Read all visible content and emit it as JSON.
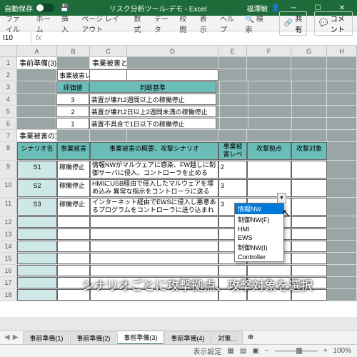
{
  "titlebar": {
    "autosave": "自動保存",
    "title": "リスク分析ツール-デモ - Excel",
    "user": "福澤敏"
  },
  "tabs": [
    "ファイル",
    "ホーム",
    "挿入",
    "ページ レイアウト",
    "数式",
    "データ",
    "校閲",
    "表示",
    "ヘルプ",
    "検索"
  ],
  "share": "共有",
  "comment": "コメント",
  "namebox": "I10",
  "cols": [
    "A",
    "B",
    "C",
    "D",
    "E",
    "F",
    "G",
    "H"
  ],
  "sec1": "事前準備(3)",
  "sec1b": "事業被害と事業被害レベル",
  "t1title": "事業被害レベルの判断基準の定義",
  "t1h": [
    "評価値",
    "判断基準"
  ],
  "t1r": [
    [
      "3",
      "装置が壊れ2週間以上の稼働停止"
    ],
    [
      "2",
      "装置が壊れ2日以上2週間未満の稼働停止"
    ],
    [
      "1",
      "装置不具合で1日以下の稼働停止"
    ]
  ],
  "sec2": "事業被害の定義",
  "t2h": [
    "シナリオ名",
    "事業被害",
    "事業被害の概要、攻撃シナリオ",
    "事業被害レベル",
    "攻撃拠点",
    "攻撃対象"
  ],
  "t2r": [
    [
      "S1",
      "稼働停止",
      "情報NWがマルウェアに感染、FW越しに制御サーバに侵入、コントローラを止める",
      "2",
      "",
      ""
    ],
    [
      "S2",
      "稼働停止",
      "HMIにUSB経由で侵入したマルウェアを埋め込み 異常な指示をコントローラに送る",
      "3",
      "",
      ""
    ],
    [
      "S3",
      "稼働停止",
      "インターネット経由でEWSに侵入し悪意あるプログラムをコントローラに送り込まれる",
      "3",
      "",
      ""
    ]
  ],
  "dropdown": [
    "情報NW",
    "制御NW(F)",
    "HMI",
    "EWS",
    "制御NW(I)",
    "Controller"
  ],
  "overlay": "シナリオごとに攻撃拠点、攻撃対象を選択",
  "sheets": [
    "事前準備(1)",
    "事前準備(2)",
    "事前準備(3)",
    "事前準備(4)",
    "対策..."
  ],
  "status": {
    "display": "表示設定",
    "zoom": "100%"
  }
}
